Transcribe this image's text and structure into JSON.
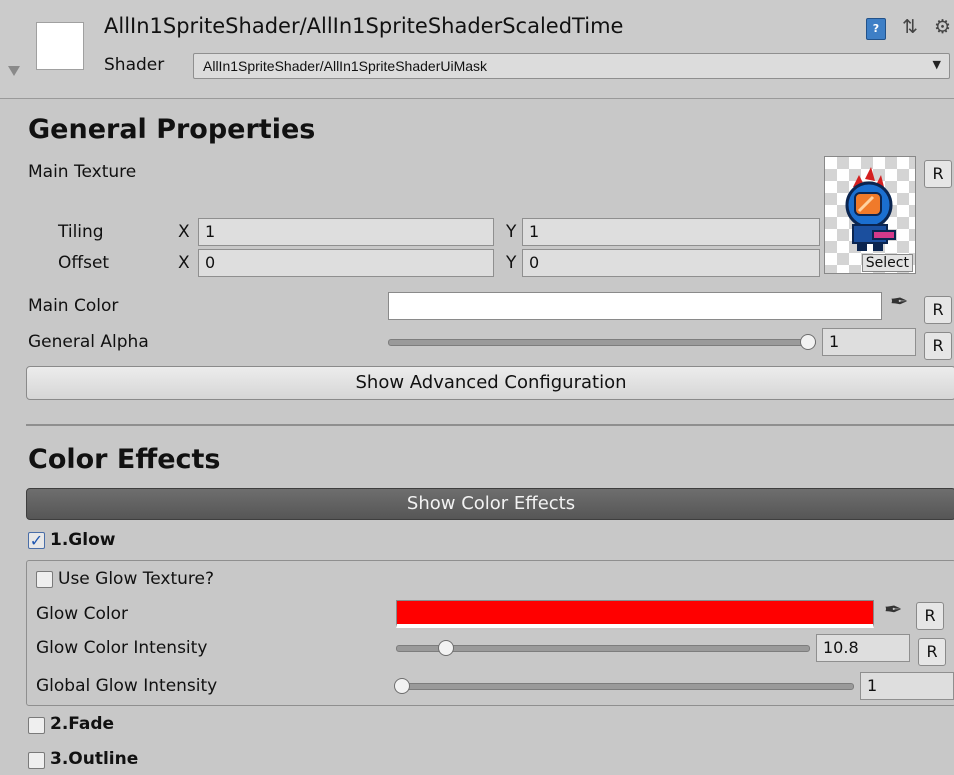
{
  "header": {
    "material_title": "AllIn1SpriteShader/AllIn1SpriteShaderScaledTime",
    "shader_label": "Shader",
    "shader_value": "AllIn1SpriteShader/AllIn1SpriteShaderUiMask"
  },
  "general": {
    "heading": "General Properties",
    "main_texture_label": "Main Texture",
    "tiling_label": "Tiling",
    "offset_label": "Offset",
    "x_label": "X",
    "y_label": "Y",
    "tiling_x": "1",
    "tiling_y": "1",
    "offset_x": "0",
    "offset_y": "0",
    "select_label": "Select",
    "reset_label": "R",
    "main_color_label": "Main Color",
    "main_color": "#ffffff",
    "general_alpha_label": "General Alpha",
    "general_alpha_value": "1",
    "general_alpha_level": 1.0,
    "advanced_button": "Show Advanced Configuration"
  },
  "color_effects": {
    "heading": "Color Effects",
    "show_button": "Show Color Effects",
    "glow_label": "1.Glow",
    "glow_checked": true,
    "use_glow_texture_label": "Use Glow Texture?",
    "glow_color_label": "Glow Color",
    "glow_color": "#ff0000",
    "glow_intensity_label": "Glow Color Intensity",
    "glow_intensity_value": "10.8",
    "glow_intensity_level": 0.11,
    "global_glow_label": "Global Glow Intensity",
    "global_glow_value": "1",
    "global_glow_level": 0.0,
    "fade_label": "2.Fade",
    "outline_label": "3.Outline"
  }
}
